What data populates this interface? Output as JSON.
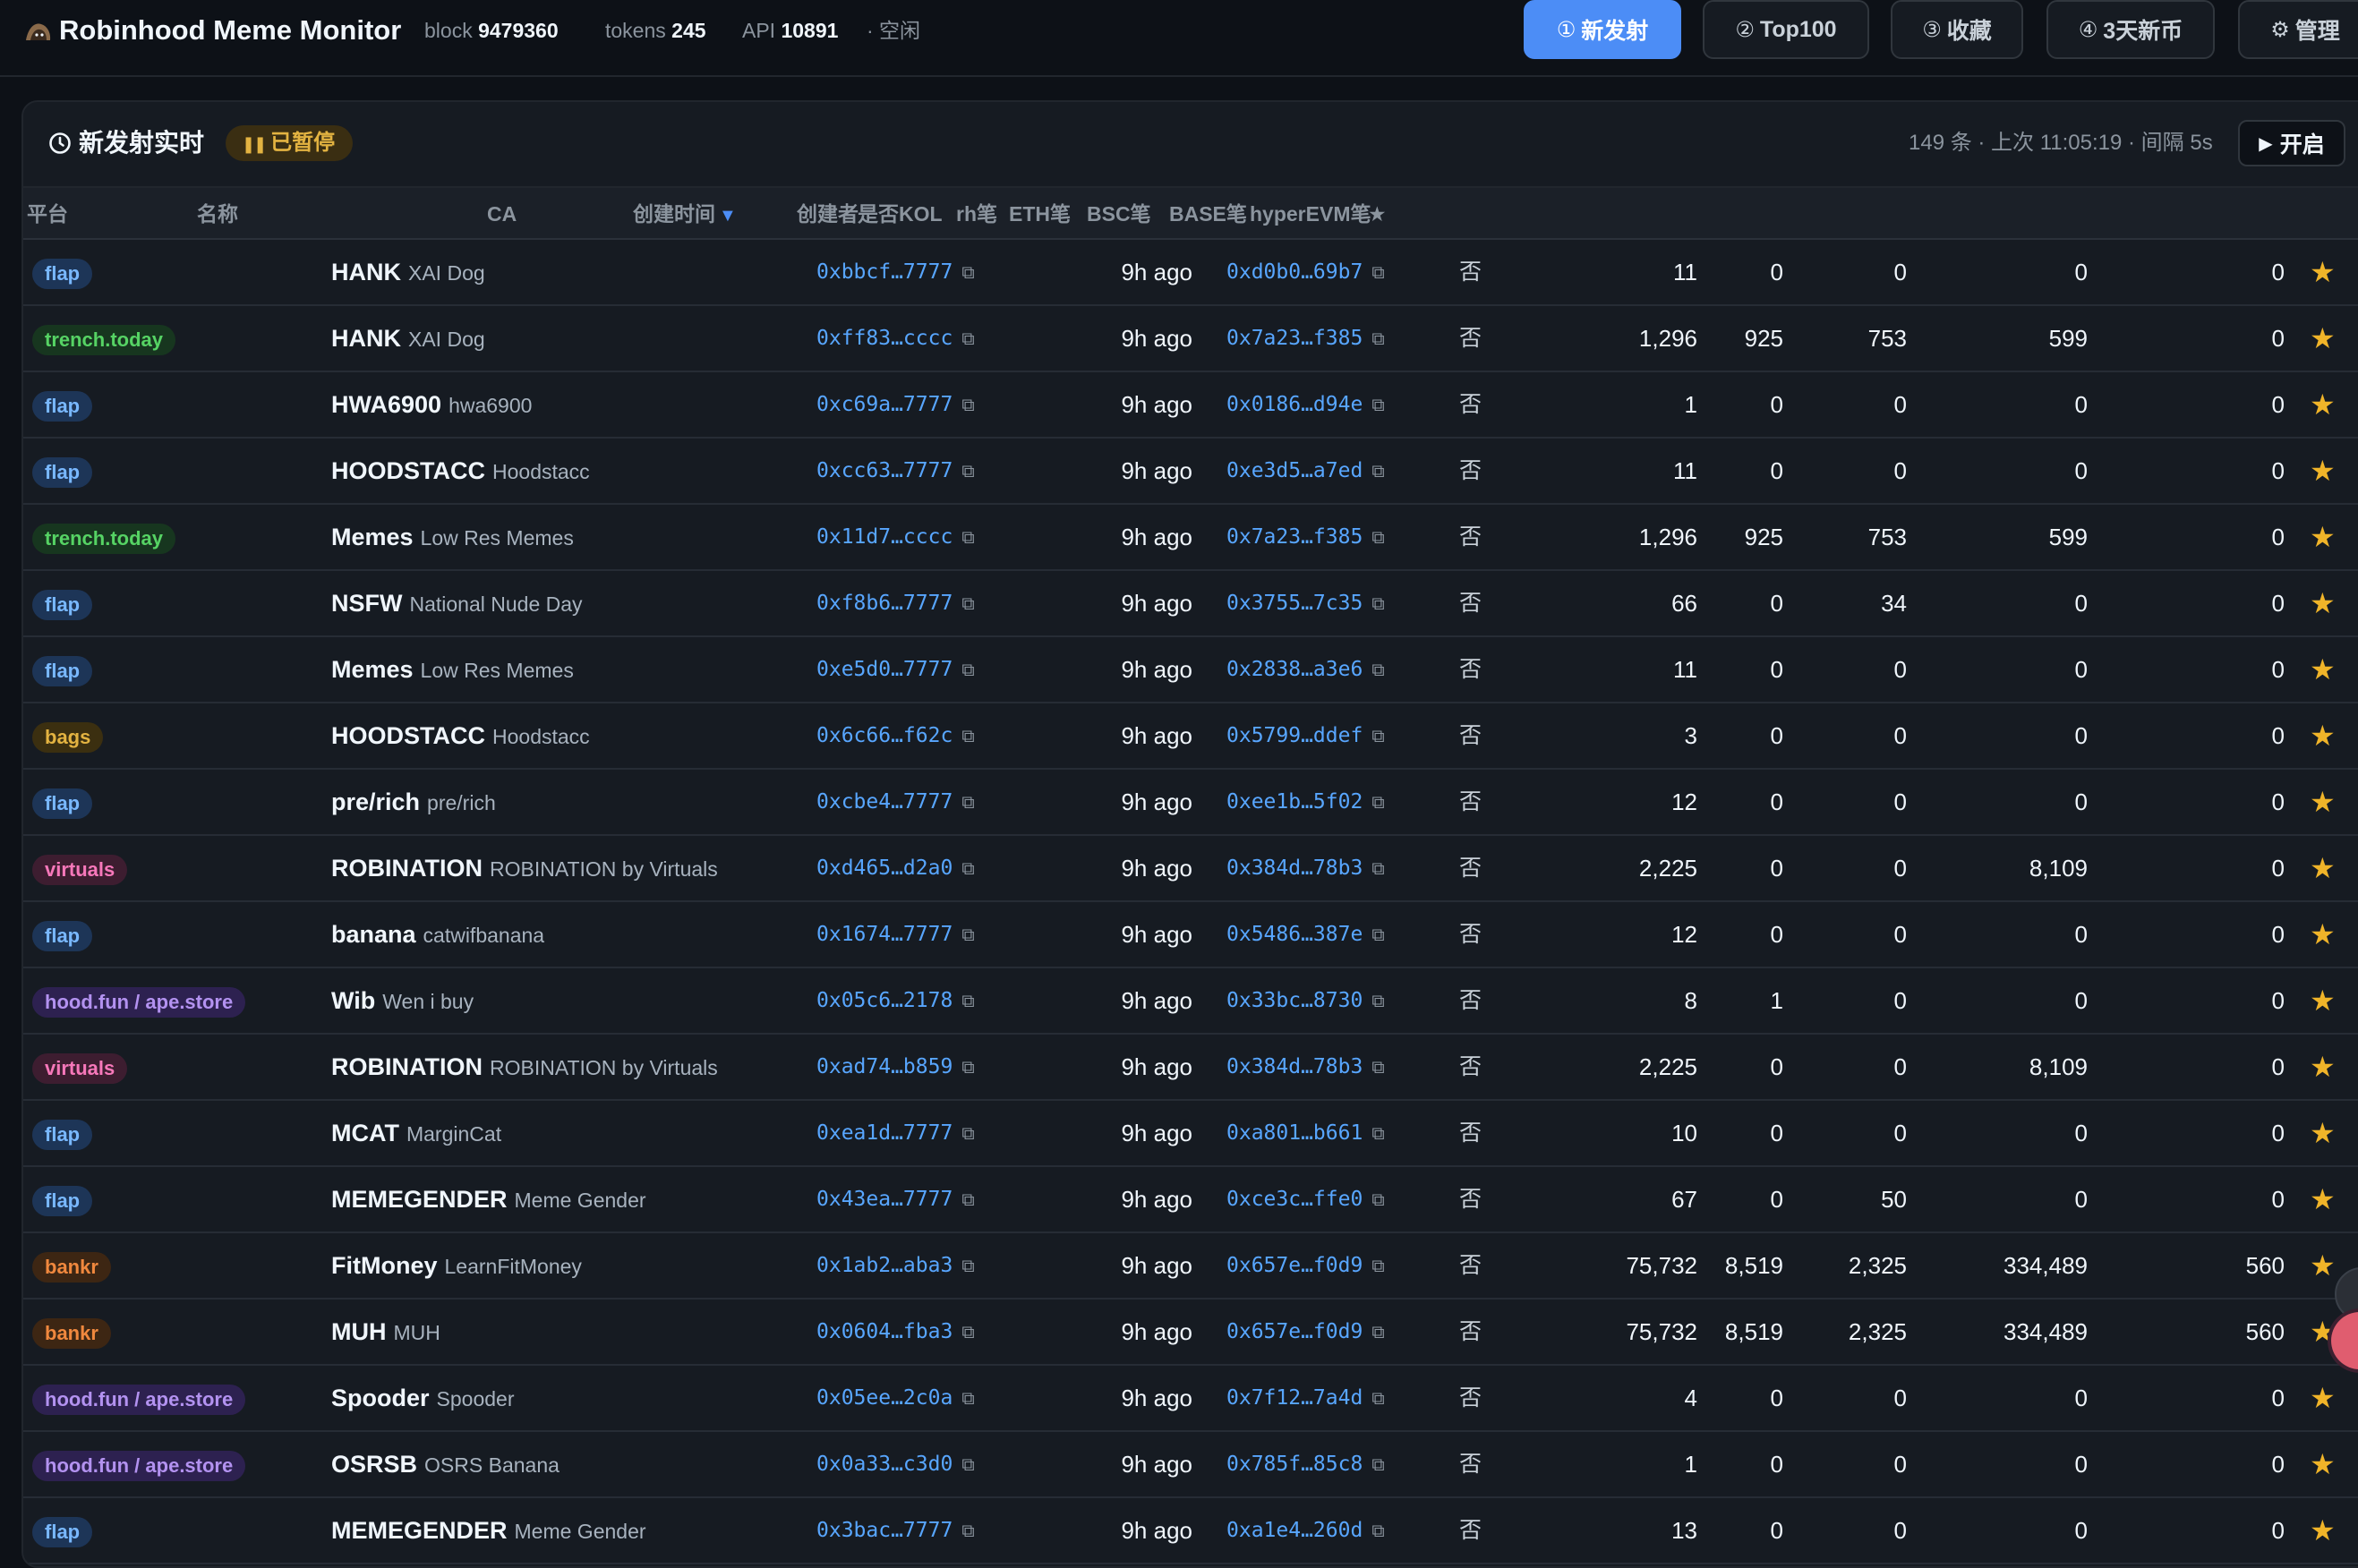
{
  "header": {
    "title": "Robinhood Meme Monitor",
    "block_label": "block",
    "block_value": "9479360",
    "tokens_label": "tokens",
    "tokens_value": "245",
    "api_label": "API",
    "api_value": "10891",
    "status": "· 空闲",
    "nav": [
      {
        "glyph": "①",
        "label": "新发射",
        "active": true
      },
      {
        "glyph": "②",
        "label": "Top100",
        "active": false
      },
      {
        "glyph": "③",
        "label": "收藏",
        "active": false
      },
      {
        "glyph": "④",
        "label": "3天新币",
        "active": false
      },
      {
        "glyph": "⚙",
        "label": "管理",
        "active": false
      }
    ]
  },
  "panel": {
    "title": "新发射实时",
    "paused_label": "已暂停",
    "meta": "149 条 · 上次 11:05:19 · 间隔 5s",
    "open_label": "开启"
  },
  "table": {
    "columns": {
      "platform": "平台",
      "name": "名称",
      "ca": "CA",
      "created": "创建时间",
      "sort_arrow": "▼",
      "creator": "创建者",
      "kol": "是否KOL",
      "rh": "rh笔",
      "eth": "ETH笔",
      "bsc": "BSC笔",
      "base": "BASE笔",
      "hyper": "hyperEVM笔",
      "fav": "★"
    },
    "copy_icon": "⧉",
    "star_icon": "★",
    "rows": [
      {
        "platform": "flap",
        "pclass": "b-flap",
        "symbol": "HANK",
        "name": "XAI Dog",
        "ca": "0xbbcf…7777",
        "time": "9h ago",
        "creator": "0xd0b0…69b7",
        "kol": "否",
        "rh": "11",
        "eth": "0",
        "bsc": "0",
        "base": "0",
        "hyper": "0"
      },
      {
        "platform": "trench.today",
        "pclass": "b-trench",
        "symbol": "HANK",
        "name": "XAI Dog",
        "ca": "0xff83…cccc",
        "time": "9h ago",
        "creator": "0x7a23…f385",
        "kol": "否",
        "rh": "1,296",
        "eth": "925",
        "bsc": "753",
        "base": "599",
        "hyper": "0"
      },
      {
        "platform": "flap",
        "pclass": "b-flap",
        "symbol": "HWA6900",
        "name": "hwa6900",
        "ca": "0xc69a…7777",
        "time": "9h ago",
        "creator": "0x0186…d94e",
        "kol": "否",
        "rh": "1",
        "eth": "0",
        "bsc": "0",
        "base": "0",
        "hyper": "0"
      },
      {
        "platform": "flap",
        "pclass": "b-flap",
        "symbol": "HOODSTACC",
        "name": "Hoodstacc",
        "ca": "0xcc63…7777",
        "time": "9h ago",
        "creator": "0xe3d5…a7ed",
        "kol": "否",
        "rh": "11",
        "eth": "0",
        "bsc": "0",
        "base": "0",
        "hyper": "0"
      },
      {
        "platform": "trench.today",
        "pclass": "b-trench",
        "symbol": "Memes",
        "name": "Low Res Memes",
        "ca": "0x11d7…cccc",
        "time": "9h ago",
        "creator": "0x7a23…f385",
        "kol": "否",
        "rh": "1,296",
        "eth": "925",
        "bsc": "753",
        "base": "599",
        "hyper": "0"
      },
      {
        "platform": "flap",
        "pclass": "b-flap",
        "symbol": "NSFW",
        "name": "National Nude Day",
        "ca": "0xf8b6…7777",
        "time": "9h ago",
        "creator": "0x3755…7c35",
        "kol": "否",
        "rh": "66",
        "eth": "0",
        "bsc": "34",
        "base": "0",
        "hyper": "0"
      },
      {
        "platform": "flap",
        "pclass": "b-flap",
        "symbol": "Memes",
        "name": "Low Res Memes",
        "ca": "0xe5d0…7777",
        "time": "9h ago",
        "creator": "0x2838…a3e6",
        "kol": "否",
        "rh": "11",
        "eth": "0",
        "bsc": "0",
        "base": "0",
        "hyper": "0"
      },
      {
        "platform": "bags",
        "pclass": "b-bags",
        "symbol": "HOODSTACC",
        "name": "Hoodstacc",
        "ca": "0x6c66…f62c",
        "time": "9h ago",
        "creator": "0x5799…ddef",
        "kol": "否",
        "rh": "3",
        "eth": "0",
        "bsc": "0",
        "base": "0",
        "hyper": "0"
      },
      {
        "platform": "flap",
        "pclass": "b-flap",
        "symbol": "pre/rich",
        "name": "pre/rich",
        "ca": "0xcbe4…7777",
        "time": "9h ago",
        "creator": "0xee1b…5f02",
        "kol": "否",
        "rh": "12",
        "eth": "0",
        "bsc": "0",
        "base": "0",
        "hyper": "0"
      },
      {
        "platform": "virtuals",
        "pclass": "b-virtuals",
        "symbol": "ROBINATION",
        "name": "ROBINATION by Virtuals",
        "ca": "0xd465…d2a0",
        "time": "9h ago",
        "creator": "0x384d…78b3",
        "kol": "否",
        "rh": "2,225",
        "eth": "0",
        "bsc": "0",
        "base": "8,109",
        "hyper": "0"
      },
      {
        "platform": "flap",
        "pclass": "b-flap",
        "symbol": "banana",
        "name": "catwifbanana",
        "ca": "0x1674…7777",
        "time": "9h ago",
        "creator": "0x5486…387e",
        "kol": "否",
        "rh": "12",
        "eth": "0",
        "bsc": "0",
        "base": "0",
        "hyper": "0"
      },
      {
        "platform": "hood.fun / ape.store",
        "pclass": "b-hood",
        "symbol": "Wib",
        "name": "Wen i buy",
        "ca": "0x05c6…2178",
        "time": "9h ago",
        "creator": "0x33bc…8730",
        "kol": "否",
        "rh": "8",
        "eth": "1",
        "bsc": "0",
        "base": "0",
        "hyper": "0"
      },
      {
        "platform": "virtuals",
        "pclass": "b-virtuals",
        "symbol": "ROBINATION",
        "name": "ROBINATION by Virtuals",
        "ca": "0xad74…b859",
        "time": "9h ago",
        "creator": "0x384d…78b3",
        "kol": "否",
        "rh": "2,225",
        "eth": "0",
        "bsc": "0",
        "base": "8,109",
        "hyper": "0"
      },
      {
        "platform": "flap",
        "pclass": "b-flap",
        "symbol": "MCAT",
        "name": "MarginCat",
        "ca": "0xea1d…7777",
        "time": "9h ago",
        "creator": "0xa801…b661",
        "kol": "否",
        "rh": "10",
        "eth": "0",
        "bsc": "0",
        "base": "0",
        "hyper": "0"
      },
      {
        "platform": "flap",
        "pclass": "b-flap",
        "symbol": "MEMEGENDER",
        "name": "Meme Gender",
        "ca": "0x43ea…7777",
        "time": "9h ago",
        "creator": "0xce3c…ffe0",
        "kol": "否",
        "rh": "67",
        "eth": "0",
        "bsc": "50",
        "base": "0",
        "hyper": "0"
      },
      {
        "platform": "bankr",
        "pclass": "b-bankr",
        "symbol": "FitMoney",
        "name": "LearnFitMoney",
        "ca": "0x1ab2…aba3",
        "time": "9h ago",
        "creator": "0x657e…f0d9",
        "kol": "否",
        "rh": "75,732",
        "eth": "8,519",
        "bsc": "2,325",
        "base": "334,489",
        "hyper": "560"
      },
      {
        "platform": "bankr",
        "pclass": "b-bankr",
        "symbol": "MUH",
        "name": "MUH",
        "ca": "0x0604…fba3",
        "time": "9h ago",
        "creator": "0x657e…f0d9",
        "kol": "否",
        "rh": "75,732",
        "eth": "8,519",
        "bsc": "2,325",
        "base": "334,489",
        "hyper": "560"
      },
      {
        "platform": "hood.fun / ape.store",
        "pclass": "b-hood",
        "symbol": "Spooder",
        "name": "Spooder",
        "ca": "0x05ee…2c0a",
        "time": "9h ago",
        "creator": "0x7f12…7a4d",
        "kol": "否",
        "rh": "4",
        "eth": "0",
        "bsc": "0",
        "base": "0",
        "hyper": "0"
      },
      {
        "platform": "hood.fun / ape.store",
        "pclass": "b-hood",
        "symbol": "OSRSB",
        "name": "OSRS Banana",
        "ca": "0x0a33…c3d0",
        "time": "9h ago",
        "creator": "0x785f…85c8",
        "kol": "否",
        "rh": "1",
        "eth": "0",
        "bsc": "0",
        "base": "0",
        "hyper": "0"
      },
      {
        "platform": "flap",
        "pclass": "b-flap",
        "symbol": "MEMEGENDER",
        "name": "Meme Gender",
        "ca": "0x3bac…7777",
        "time": "9h ago",
        "creator": "0xa1e4…260d",
        "kol": "否",
        "rh": "13",
        "eth": "0",
        "bsc": "0",
        "base": "0",
        "hyper": "0"
      }
    ]
  }
}
